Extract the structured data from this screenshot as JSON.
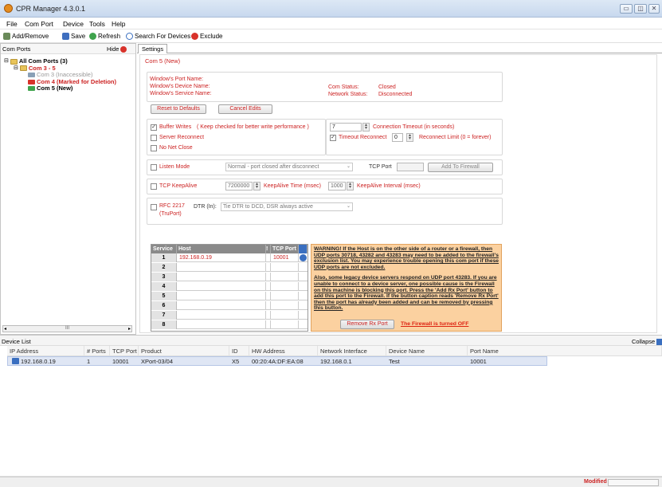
{
  "window": {
    "title": "CPR Manager 4.3.0.1"
  },
  "menu": {
    "items": [
      "File",
      "Com Port",
      "Device",
      "Tools",
      "Help"
    ]
  },
  "toolbar": {
    "add_remove": "Add/Remove",
    "save": "Save",
    "refresh": "Refresh",
    "search": "Search For Devices",
    "exclude": "Exclude"
  },
  "left_pane": {
    "title": "Com Ports",
    "hide": "Hide",
    "tree": {
      "root": "All Com Ports (3)",
      "group": "Com 3 - 5",
      "items": [
        "Com 3 (Inaccessible)",
        "Com 4 (Marked for Deletion)",
        "Com 5 (New)"
      ]
    },
    "scroll_label": "III"
  },
  "tab": {
    "settings": "Settings"
  },
  "settings": {
    "group_title": "Com 5 (New)",
    "info": {
      "port_name_label": "Window's Port Name:",
      "device_name_label": "Window's Device Name:",
      "service_name_label": "Window's Service Name:",
      "com_status_label": "Com Status:",
      "com_status_value": "Closed",
      "network_status_label": "Network Status:",
      "network_status_value": "Disconnected"
    },
    "reset_defaults": "Reset to Defaults",
    "cancel_edits": "Cancel Edits",
    "buffer_writes": "Buffer Writes",
    "buffer_writes_note": "( Keep checked for better write performance )",
    "server_reconnect": "Server Reconnect",
    "no_net_close": "No Net Close",
    "connection_timeout_value": "7",
    "connection_timeout_label": "Connection Timeout (in seconds)",
    "timeout_reconnect": "Timeout Reconnect",
    "reconnect_limit_value": "0",
    "reconnect_limit_label": "Reconnect Limit (0 = forever)",
    "listen_mode": "Listen Mode",
    "listen_mode_select": "Normal - port closed after disconnect",
    "tcp_port_label": "TCP Port",
    "add_to_firewall": "Add To Firewall",
    "tcp_keepalive": "TCP KeepAlive",
    "keepalive_time_value": "7200000",
    "keepalive_time_label": "KeepAlive Time (msec)",
    "keepalive_interval_value": "1000",
    "keepalive_interval_label": "KeepAlive Interval (msec)",
    "rfc2217": "RFC 2217",
    "truport": "(TruPort)",
    "dtr_label": "DTR (In):",
    "dtr_select": "Tie DTR to DCD, DSR always active"
  },
  "service_table": {
    "headers": [
      "Service",
      "Host",
      "!",
      "TCP Port"
    ],
    "rows": [
      {
        "n": "1",
        "host": "192.168.0.19",
        "port": "10001"
      },
      {
        "n": "2",
        "host": "",
        "port": ""
      },
      {
        "n": "3",
        "host": "",
        "port": ""
      },
      {
        "n": "4",
        "host": "",
        "port": ""
      },
      {
        "n": "5",
        "host": "",
        "port": ""
      },
      {
        "n": "6",
        "host": "",
        "port": ""
      },
      {
        "n": "7",
        "host": "",
        "port": ""
      },
      {
        "n": "8",
        "host": "",
        "port": ""
      }
    ]
  },
  "warning": {
    "p1": "WARNING! If the Host is on the other side of a router or a firewall, then UDP ports 30718, 43282 and 43283 may need to be added to the firewall's exclusion list. You may experience trouble opening this com port if these UDP ports are not excluded.",
    "p2": "Also, some legacy device servers respond on UDP port 43283. If you are unable to connect to a device server, one possible cause is the Firewall on this machine is blocking this port. Press the 'Add Rx Port' button to add this port to the Firewall. If the button caption reads 'Remove Rx Port' then the port has already been added and can be removed by pressing this button.",
    "remove_rx": "Remove Rx Port",
    "firewall_status": "The Firewall is turned OFF"
  },
  "device_list": {
    "title": "Device List",
    "collapse": "Collapse",
    "headers": [
      "IP Address",
      "# Ports",
      "TCP Port",
      "Product",
      "ID",
      "HW Address",
      "Network Interface",
      "Device Name",
      "Port Name"
    ],
    "rows": [
      [
        "192.168.0.19",
        "1",
        "10001",
        "XPort-03/04",
        "X5",
        "00:20:4A:DF:EA:08",
        "192.168.0.1",
        "Test",
        "10001"
      ]
    ]
  },
  "status": {
    "modified": "Modified"
  },
  "colors": {
    "accent_red": "#cc2222",
    "warning_bg": "#fbd1a0",
    "title_bar": "#c7d8ee"
  }
}
